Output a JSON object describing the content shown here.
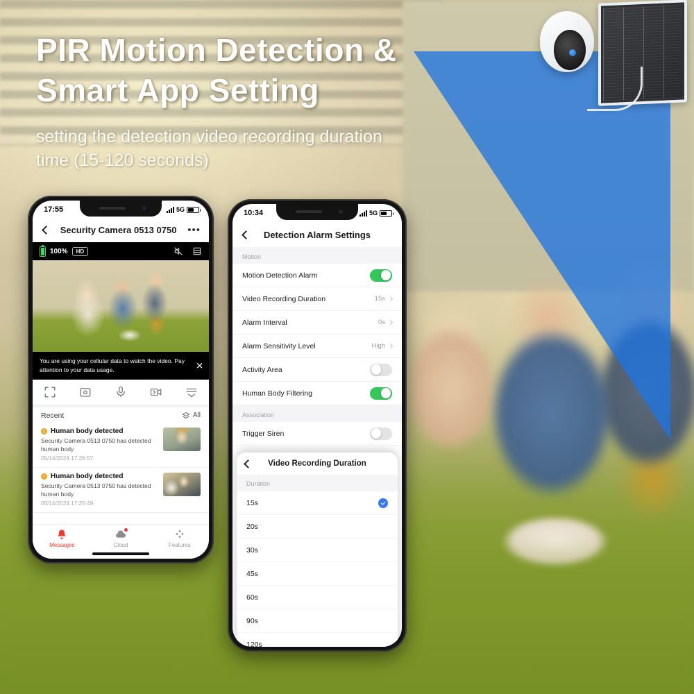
{
  "hero": {
    "headline_line1": "PIR Motion Detection &",
    "headline_line2": "Smart App Setting",
    "sub_line1": "setting the detection video recording duration",
    "sub_line2": "time (15-120 seconds)"
  },
  "device": {
    "camera_icon": "security-camera",
    "solar_panel_icon": "solar-panel",
    "detection_cone_color": "#2078e0"
  },
  "phone_left": {
    "status": {
      "time": "17:55",
      "network": "5G",
      "signal_icon": "signal-bars",
      "battery_icon": "battery"
    },
    "nav": {
      "back_icon": "chevron-left-icon",
      "title": "Security Camera 0513 0750",
      "more_icon": "more-dots-icon"
    },
    "player": {
      "battery_label": "100%",
      "quality_label": "HD",
      "mute_icon": "speaker-muted-icon",
      "list_icon": "list-icon"
    },
    "toast": {
      "text": "You are using your cellular data to watch the video. Pay attention to your data usage.",
      "close_icon": "close-icon"
    },
    "controls": [
      {
        "icon": "fullscreen-icon"
      },
      {
        "icon": "snapshot-icon"
      },
      {
        "icon": "microphone-icon"
      },
      {
        "icon": "record-video-icon"
      },
      {
        "icon": "playback-list-icon"
      }
    ],
    "recent": {
      "label": "Recent",
      "filter_icon": "layers-icon",
      "filter_label": "All"
    },
    "events": [
      {
        "title": "Human body detected",
        "subtitle": "Security Camera 0513 0750 has detected human body",
        "time": "05/14/2024 17:26:57",
        "badge_icon": "alert-icon",
        "thumb": "boy-thumbnail"
      },
      {
        "title": "Human body detected",
        "subtitle": "Security Camera 0513 0750 has detected human body",
        "time": "05/14/2024 17:25:49",
        "badge_icon": "alert-icon",
        "thumb": "family-thumbnail"
      }
    ],
    "tabs": [
      {
        "label": "Messages",
        "icon": "bell-icon",
        "active": true,
        "badge": false
      },
      {
        "label": "Cloud",
        "icon": "cloud-icon",
        "active": false,
        "badge": true
      },
      {
        "label": "Features",
        "icon": "features-icon",
        "active": false,
        "badge": false
      }
    ],
    "active_color": "#ee3b2e"
  },
  "phone_right": {
    "status": {
      "time": "10:34",
      "network": "5G",
      "signal_icon": "signal-bars",
      "battery_icon": "battery"
    },
    "nav": {
      "back_icon": "chevron-left-icon",
      "title": "Detection Alarm Settings"
    },
    "sections": [
      {
        "header": "Motion",
        "rows": [
          {
            "label": "Motion Detection Alarm",
            "control": "toggle",
            "value": "on"
          },
          {
            "label": "Video Recording Duration",
            "control": "value",
            "value": "15s"
          },
          {
            "label": "Alarm Interval",
            "control": "value",
            "value": "0s"
          },
          {
            "label": "Alarm Sensitivity Level",
            "control": "value",
            "value": "High"
          },
          {
            "label": "Activity Area",
            "control": "toggle",
            "value": "off"
          },
          {
            "label": "Human Body Filtering",
            "control": "toggle",
            "value": "on"
          }
        ]
      },
      {
        "header": "Association",
        "rows": [
          {
            "label": "Trigger Siren",
            "control": "toggle",
            "value": "off"
          }
        ]
      }
    ],
    "toggle_on_color": "#34C759"
  },
  "sheet": {
    "back_icon": "chevron-left-icon",
    "title": "Video Recording Duration",
    "section_header": "Duration",
    "selected": "15s",
    "check_icon": "check-circle-icon",
    "options": [
      "15s",
      "20s",
      "30s",
      "45s",
      "60s",
      "90s",
      "120s"
    ]
  }
}
